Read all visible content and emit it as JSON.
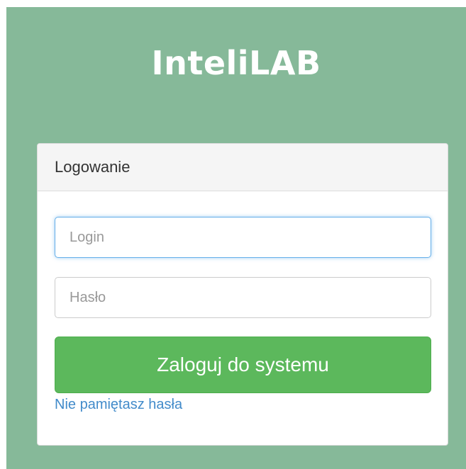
{
  "app": {
    "title": "InteliLAB"
  },
  "login_card": {
    "header": "Logowanie",
    "login_placeholder": "Login",
    "password_placeholder": "Hasło",
    "submit_label": "Zaloguj do systemu",
    "forgot_password_label": "Nie pamiętasz hasła"
  },
  "colors": {
    "background": "#86b999",
    "button": "#5cb85c",
    "link": "#428bca",
    "focus_border": "#66afe9"
  }
}
